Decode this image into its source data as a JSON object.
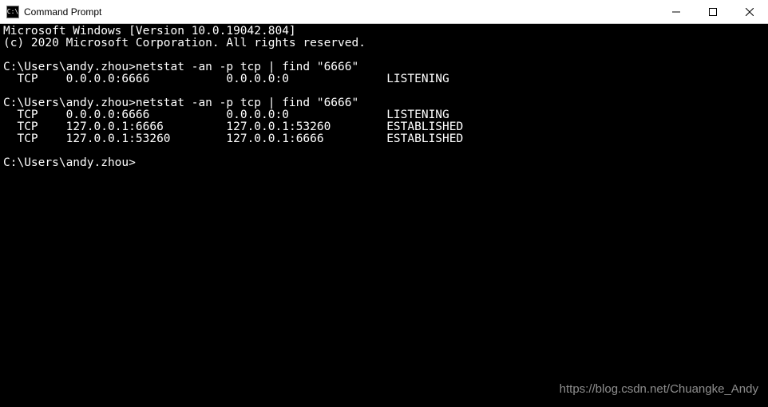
{
  "window": {
    "title": "Command Prompt",
    "icon_label": "C:\\"
  },
  "console": {
    "header_line1": "Microsoft Windows [Version 10.0.19042.804]",
    "header_line2": "(c) 2020 Microsoft Corporation. All rights reserved.",
    "prompt_path": "C:\\Users\\andy.zhou>",
    "sessions": [
      {
        "command": "netstat -an -p tcp | find \"6666\"",
        "rows": [
          {
            "proto": "TCP",
            "local": "0.0.0.0:6666",
            "foreign": "0.0.0.0:0",
            "state": "LISTENING"
          }
        ]
      },
      {
        "command": "netstat -an -p tcp | find \"6666\"",
        "rows": [
          {
            "proto": "TCP",
            "local": "0.0.0.0:6666",
            "foreign": "0.0.0.0:0",
            "state": "LISTENING"
          },
          {
            "proto": "TCP",
            "local": "127.0.0.1:6666",
            "foreign": "127.0.0.1:53260",
            "state": "ESTABLISHED"
          },
          {
            "proto": "TCP",
            "local": "127.0.0.1:53260",
            "foreign": "127.0.0.1:6666",
            "state": "ESTABLISHED"
          }
        ]
      }
    ]
  },
  "watermark": "https://blog.csdn.net/Chuangke_Andy"
}
